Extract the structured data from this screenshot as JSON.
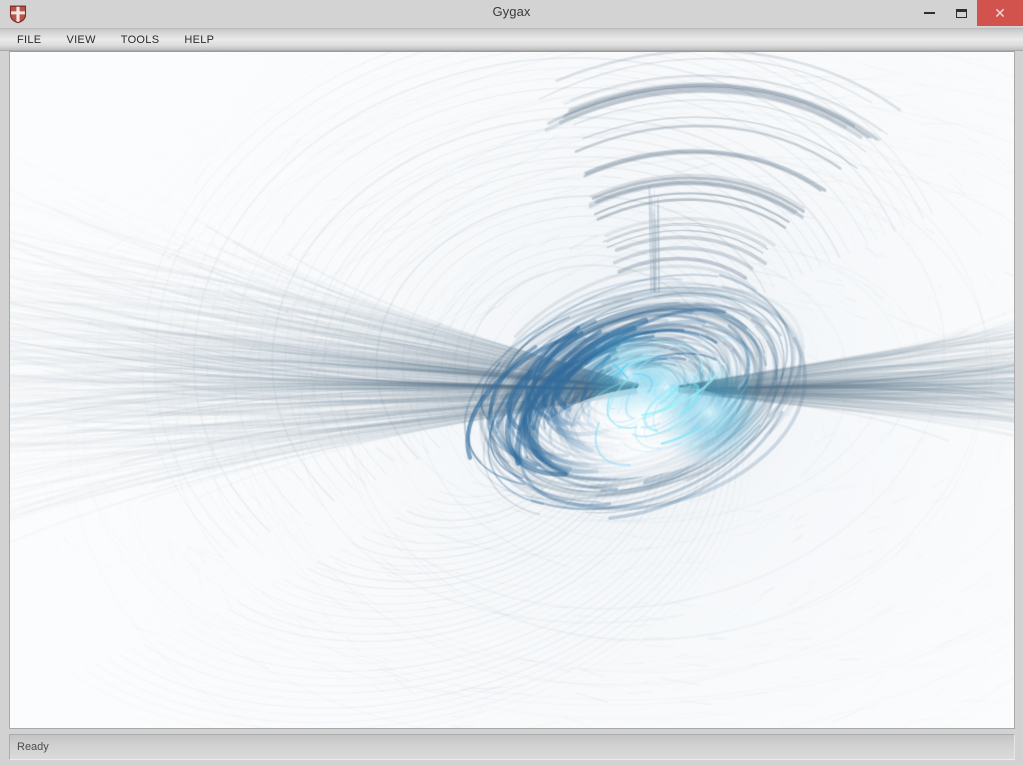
{
  "window": {
    "title": "Gygax",
    "icon": "shield-icon",
    "controls": {
      "minimize_label": "–",
      "minimize_name": "minimize-icon",
      "maximize_label": "",
      "maximize_name": "maximize-icon",
      "close_label": "✕",
      "close_name": "close-icon"
    },
    "colors": {
      "titlebar_bg": "#d3d3d3",
      "menubar_bg": "#eaeaea",
      "close_button_bg": "#d2534e",
      "canvas_bg": "#fbfcfd",
      "frame_border": "#a8a8a8",
      "fractal_accent": "#1f78b4",
      "fractal_highlight": "#22c3ee",
      "fractal_dark": "#3d5a70"
    }
  },
  "menu": {
    "items": [
      {
        "label": "FILE",
        "name": "menu-item-file"
      },
      {
        "label": "VIEW",
        "name": "menu-item-view"
      },
      {
        "label": "TOOLS",
        "name": "menu-item-tools"
      },
      {
        "label": "HELP",
        "name": "menu-item-help"
      }
    ]
  },
  "canvas": {
    "name": "fractal-render-canvas",
    "description": "fractal flame render",
    "background": "#fbfcfd"
  },
  "status": {
    "text": "Ready"
  }
}
